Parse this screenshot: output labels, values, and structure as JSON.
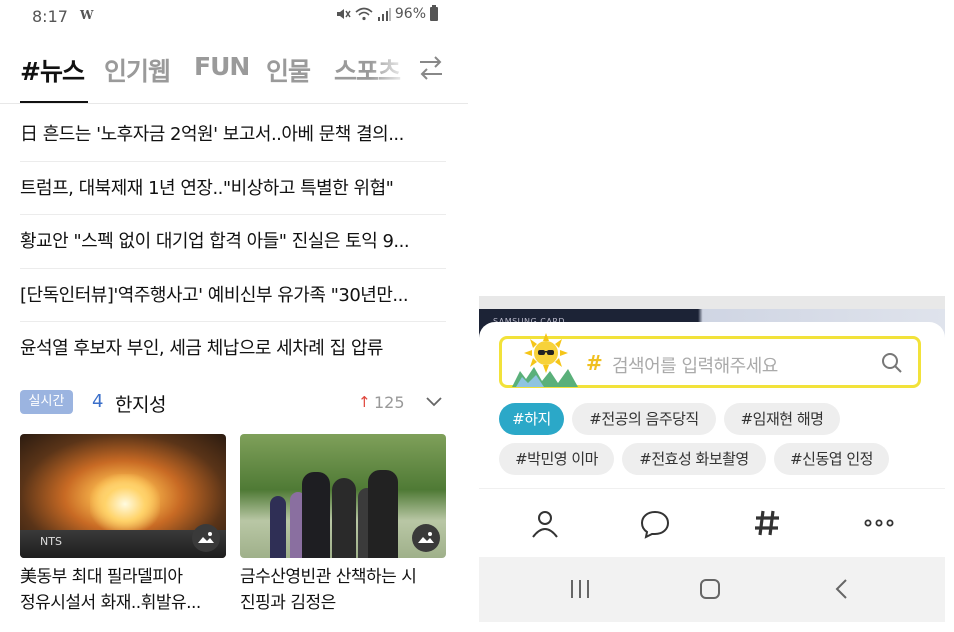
{
  "status_bar": {
    "time": "8:17",
    "app_logo": "W",
    "battery": "96%",
    "icons": [
      "mute-icon",
      "wifi-icon",
      "signal-icon",
      "battery-icon"
    ]
  },
  "tabs": [
    "#뉴스",
    "인기웹",
    "FUN",
    "인물",
    "스포츠"
  ],
  "active_tab": 0,
  "news": [
    "日 흔드는 '노후자금 2억원' 보고서..아베 문책 결의...",
    "트럼프, 대북제재 1년 연장..\"비상하고 특별한 위협\"",
    "황교안 \"스펙 없이 대기업 합격 아들\" 진실은 토익 9...",
    "[단독인터뷰]'역주행사고' 예비신부 유가족 \"30년만...",
    "윤석열 후보자 부인, 세금 체납으로 세차례 집 압류"
  ],
  "realtime": {
    "badge": "실시간",
    "rank": "4",
    "keyword": "한지성",
    "arrow": "↑",
    "count": "125"
  },
  "cards": [
    {
      "caption_line1": "美동부 최대 필라델피아",
      "caption_line2": "정유시설서 화재..휘발유...",
      "watermark": "NTS"
    },
    {
      "caption_line1": "금수산영빈관 산책하는 시",
      "caption_line2": "진핑과 김정은"
    }
  ],
  "ad": {
    "text": "SAMSUNG CARD"
  },
  "search": {
    "hash": "#",
    "placeholder": "검색어를 입력해주세요"
  },
  "chips": [
    "#하지",
    "#전공의 음주당직",
    "#임재현 해명",
    "#박민영 이마",
    "#전효성 화보촬영",
    "#신동엽 인정"
  ],
  "active_chip": 0,
  "bottom_nav": [
    "person-icon",
    "chat-icon",
    "hash-icon",
    "more-icon"
  ],
  "colors": {
    "accent_blue": "#2ba8c8",
    "search_border": "#f2e23a",
    "rank_blue": "#3b6fc9",
    "up_red": "#e0493f",
    "badge_blue": "#9bb4e0"
  }
}
